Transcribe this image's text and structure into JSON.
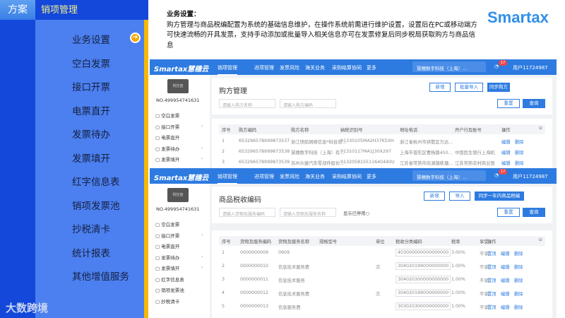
{
  "outer": {
    "tab": "方案",
    "header": "销项管理",
    "menu": [
      "业务设置",
      "空白发票",
      "接口开票",
      "电票直开",
      "发票待办",
      "发票填开",
      "红字信息表",
      "销项发票池",
      "抄税清卡",
      "统计报表",
      "其他增值服务"
    ],
    "active_index": 0,
    "footer_logo": "大数跨境"
  },
  "description": {
    "title": "业务设置：",
    "body": "购方管理与商品税编配置为系统的基础信息维护，在操作系统前需进行维护设置，设置后在PC或移动端方可快速流畅的开具发票，支持手动添加或批量导入相关信息亦可在发票修复后同步税局获取购方与商品信息"
  },
  "brand_logo": "Smartax",
  "app": {
    "brand": "Smartax慧穗云",
    "nav": [
      "销项管理",
      "进项管理",
      "发票风险",
      "海关业务",
      "采购结算协同",
      "更多"
    ],
    "company": "慧穗数字科技（上海）...",
    "badge": "17",
    "user": "用户11724987",
    "device": "税控盘",
    "device_no": "NO.499954741631",
    "side": [
      "空白发票",
      "接口开票",
      "电票直开",
      "发票待办",
      "发票填开",
      "红字信息表",
      "销项发票池",
      "抄税清卡"
    ]
  },
  "shot1": {
    "title": "购方管理",
    "buttons": [
      "新增",
      "批量导入",
      "同步购方"
    ],
    "placeholders": [
      "请输入购方名称",
      "请输入购方编码"
    ],
    "reset": "重置",
    "query": "查询",
    "columns": [
      "序号",
      "购方编码",
      "购方名称",
      "纳税识别号",
      "地址电话",
      "开户行及账号",
      "操作"
    ],
    "rows": [
      [
        "1",
        "653296578999873537",
        "浙江快航网络信息*科技有...",
        "91330105MA2H37K5XH",
        "浙江省杭州市拱墅区万达...",
        ""
      ],
      [
        "2",
        "653296578999873538",
        "慧穗数字科技（上海）有...",
        "91310117MA1J30X297",
        "上海市普陀区曹杨路450...",
        "中国民生银行上海机"
      ],
      [
        "3",
        "653296578999873539",
        "苏州众捷汽车零部件股份...",
        "913205815511640440U",
        "江苏省常熟市尚湖镇练塘...",
        "江苏常熟农村商业银"
      ]
    ],
    "actions": [
      "编辑",
      "删除"
    ]
  },
  "shot2": {
    "title": "商品税收编码",
    "buttons": [
      "新增",
      "导入",
      "同步一年内商品税编"
    ],
    "placeholders": [
      "请输入货物及服务编码",
      "请输入货物及服务名称"
    ],
    "show_disabled": "显示已停用",
    "reset": "重置",
    "query": "查询",
    "columns": [
      "序号",
      "货物及服务编码",
      "货物及服务名称",
      "规格型号",
      "单位",
      "税收分类编码",
      "税率",
      "享受",
      "操作"
    ],
    "rows": [
      [
        "1",
        "0000000009",
        "0909",
        "",
        "",
        "403000000000000000",
        "3.00%",
        "不享"
      ],
      [
        "2",
        "0000000010",
        "信息技术服务费",
        "",
        "次",
        "304020199000000000",
        "1.00%",
        "不享"
      ],
      [
        "3",
        "0000000011",
        "信息技术服务",
        "",
        "",
        "304020300000000000",
        "1.00%",
        "不享"
      ],
      [
        "4",
        "0000000012",
        "信息技术服务费",
        "",
        "次",
        "304020199000000000",
        "1.00%",
        "不享"
      ],
      [
        "5",
        "0000000013",
        "信息服务费",
        "",
        "",
        "303020300000000000",
        "1.00%",
        "不享"
      ]
    ],
    "actions": [
      "置顶",
      "编辑",
      "删除"
    ]
  }
}
